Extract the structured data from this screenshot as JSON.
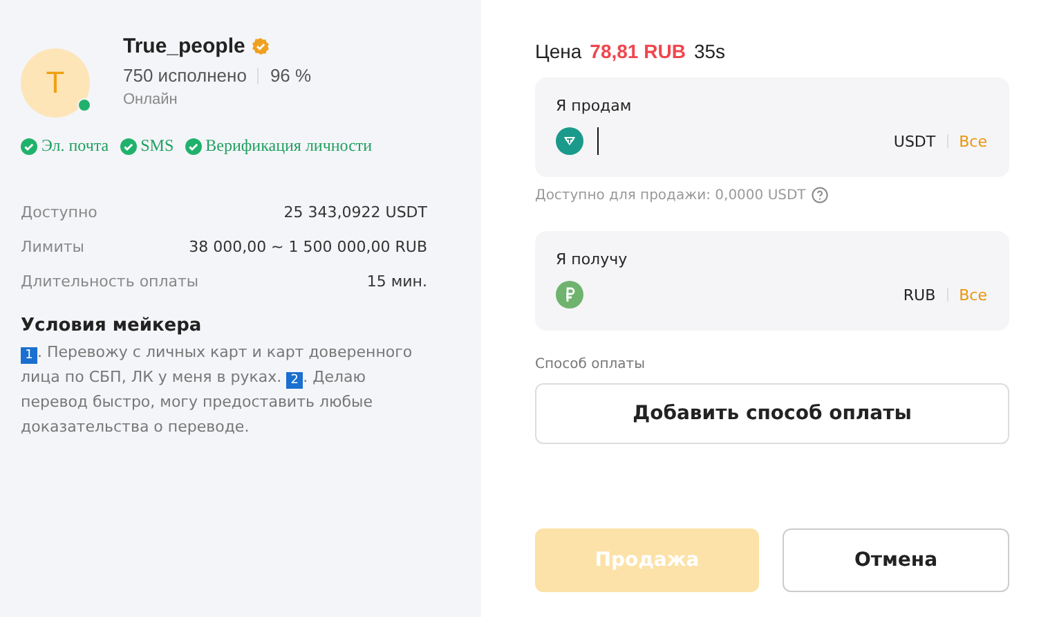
{
  "maker": {
    "initial": "T",
    "name": "True_people",
    "verified": true,
    "online": true,
    "orders": "750 исполнено",
    "completion": "96 %",
    "status": "Онлайн"
  },
  "verifications": [
    {
      "label": "Эл. почта",
      "checked": true
    },
    {
      "label": "SMS",
      "checked": true
    },
    {
      "label": "Верификация личности",
      "checked": true
    }
  ],
  "details": [
    {
      "label": "Доступно",
      "value": "25 343,0922 USDT"
    },
    {
      "label": "Лимиты",
      "value": "38 000,00 ~ 1 500 000,00 RUB"
    },
    {
      "label": "Длительность оплаты",
      "value": "15 мин."
    }
  ],
  "terms": {
    "title": "Условия мейкера",
    "parts": [
      {
        "num": "1",
        "text": ". Перевожу с личных карт и карт доверенного лица по СБП, ЛК у меня в руках. "
      },
      {
        "num": "2",
        "text": ". Делаю перевод быстро, могу предоставить любые доказательства о переводе."
      }
    ]
  },
  "price": {
    "label": "Цена",
    "value": "78,81 RUB",
    "timer": "35s"
  },
  "sell_field": {
    "label": "Я продам",
    "currency": "USDT",
    "all": "Все",
    "kind": "tether"
  },
  "available": "Доступно для продажи: 0,0000 USDT",
  "receive_field": {
    "label": "Я получу",
    "currency": "RUB",
    "all": "Все",
    "kind": "ruble"
  },
  "payment": {
    "label": "Способ оплаты",
    "button": "Добавить способ оплаты"
  },
  "buttons": [
    {
      "label": "Продажа",
      "disabled": true
    },
    {
      "label": "Отмена",
      "disabled": false
    }
  ]
}
